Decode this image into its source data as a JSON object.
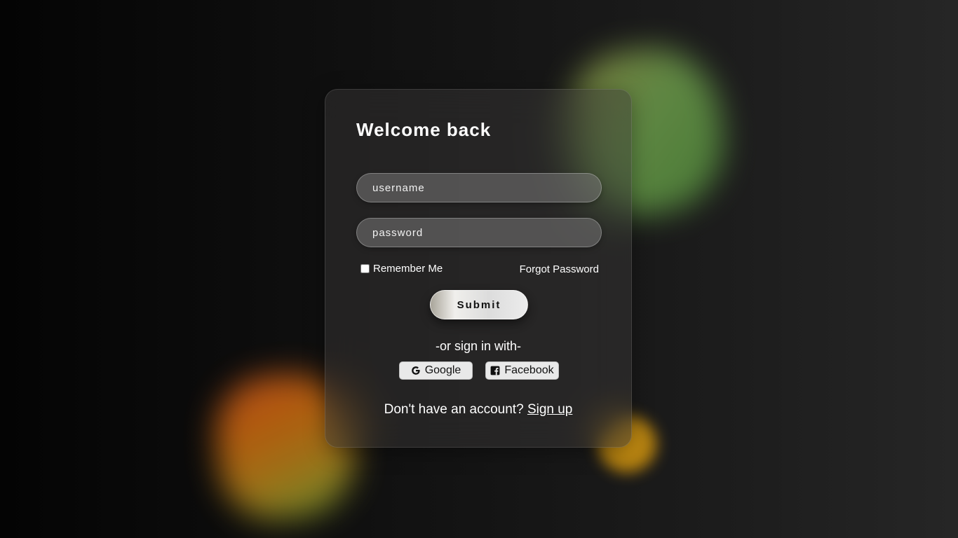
{
  "login": {
    "title": "Welcome back",
    "username_placeholder": "username",
    "password_placeholder": "password",
    "remember_label": "Remember Me",
    "forgot_label": "Forgot Password",
    "submit_label": "Submit",
    "or_text": "-or sign in with-",
    "google_label": "Google",
    "facebook_label": "Facebook",
    "signup_prompt": "Don't have an account?",
    "signup_link": "Sign up"
  },
  "icons": {
    "google": "google-icon",
    "facebook": "facebook-icon"
  },
  "colors": {
    "background": "#111111",
    "card": "#3c3a3a",
    "blob_green": "#6b9a4a",
    "blob_orange": "#c2650f",
    "blob_yellow": "#d79a12"
  }
}
